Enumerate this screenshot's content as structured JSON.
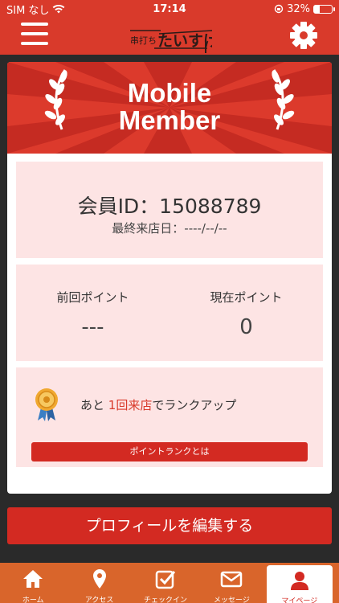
{
  "status_bar": {
    "carrier": "SIM なし",
    "time": "17:14",
    "battery": "32%",
    "battery_level": 0.32
  },
  "header": {
    "logo_text": "たいすけ",
    "logo_small": "串打ち"
  },
  "banner": {
    "title_line1": "Mobile",
    "title_line2": "Member"
  },
  "member": {
    "id_text": "会員ID：15088789",
    "last_visit": "最終来店日：----/--/--"
  },
  "points": {
    "previous_label": "前回ポイント",
    "previous_value": "---",
    "current_label": "現在ポイント",
    "current_value": "0"
  },
  "rank": {
    "prefix": "あと ",
    "highlight": "1回来店",
    "suffix": "でランクアップ",
    "button_label": "ポイントランクとは"
  },
  "profile_button": "プロフィールを編集する",
  "tabs": [
    {
      "label": "ホーム",
      "icon": "home-icon"
    },
    {
      "label": "アクセス",
      "icon": "location-pin-icon"
    },
    {
      "label": "チェックイン",
      "icon": "checkin-icon"
    },
    {
      "label": "メッセージ",
      "icon": "mail-icon"
    },
    {
      "label": "マイページ",
      "icon": "user-icon"
    }
  ],
  "colors": {
    "brand_red": "#d93a2b",
    "card_pink": "#fde4e4",
    "tab_orange": "#d9652b"
  }
}
